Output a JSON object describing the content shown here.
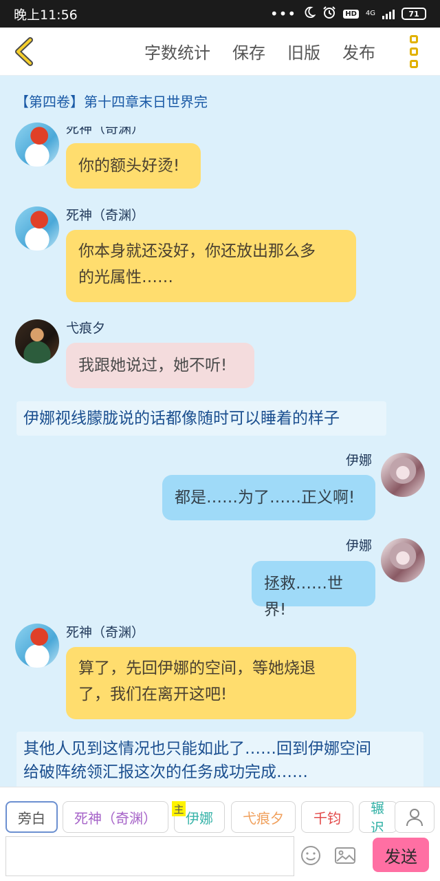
{
  "status_bar": {
    "time": "晚上11:56",
    "dots": "•••",
    "hd": "HD",
    "network": "4G",
    "battery": "71"
  },
  "nav": {
    "word_count": "字数统计",
    "save": "保存",
    "old_version": "旧版",
    "publish": "发布"
  },
  "chapter_title": "【第四卷】第十四章末日世界完",
  "messages": [
    {
      "speaker": "死神（奇渊）",
      "text": "你的额头好烫!"
    },
    {
      "speaker": "死神（奇渊）",
      "line1": "你本身就还没好，你还放出那么多",
      "line2": "的光属性……"
    },
    {
      "speaker": "弋痕夕",
      "text": "我跟她说过，她不听!"
    },
    {
      "narration": "伊娜视线朦胧说的话都像随时可以睡着的样子"
    },
    {
      "speaker": "伊娜",
      "text": "都是……为了……正义啊!"
    },
    {
      "speaker": "伊娜",
      "text": "拯救……世界!"
    },
    {
      "speaker": "死神（奇渊）",
      "line1": "算了，先回伊娜的空间，等她烧退",
      "line2": "了，我们在离开这吧!"
    },
    {
      "line1": "其他人见到这情况也只能如此了……回到伊娜空间",
      "line2": "给破阵统领汇报这次的任务成功完成……"
    }
  ],
  "roles": {
    "narrator": "旁白",
    "shen": "死神（奇渊）",
    "main_tag": "主",
    "yina": "伊娜",
    "ge": "弋痕夕",
    "qianjun": "千钧",
    "partial": "辗迟"
  },
  "input": {
    "placeholder": "",
    "send": "发送"
  },
  "colors": {
    "accent_yellow": "#e1b100",
    "bubble_yellow": "#ffdd6e",
    "bubble_pink": "#f4dcdd",
    "bubble_blue": "#9fdaf8",
    "send_pink": "#ff6fa3",
    "chat_bg": "#dcf0fb"
  }
}
